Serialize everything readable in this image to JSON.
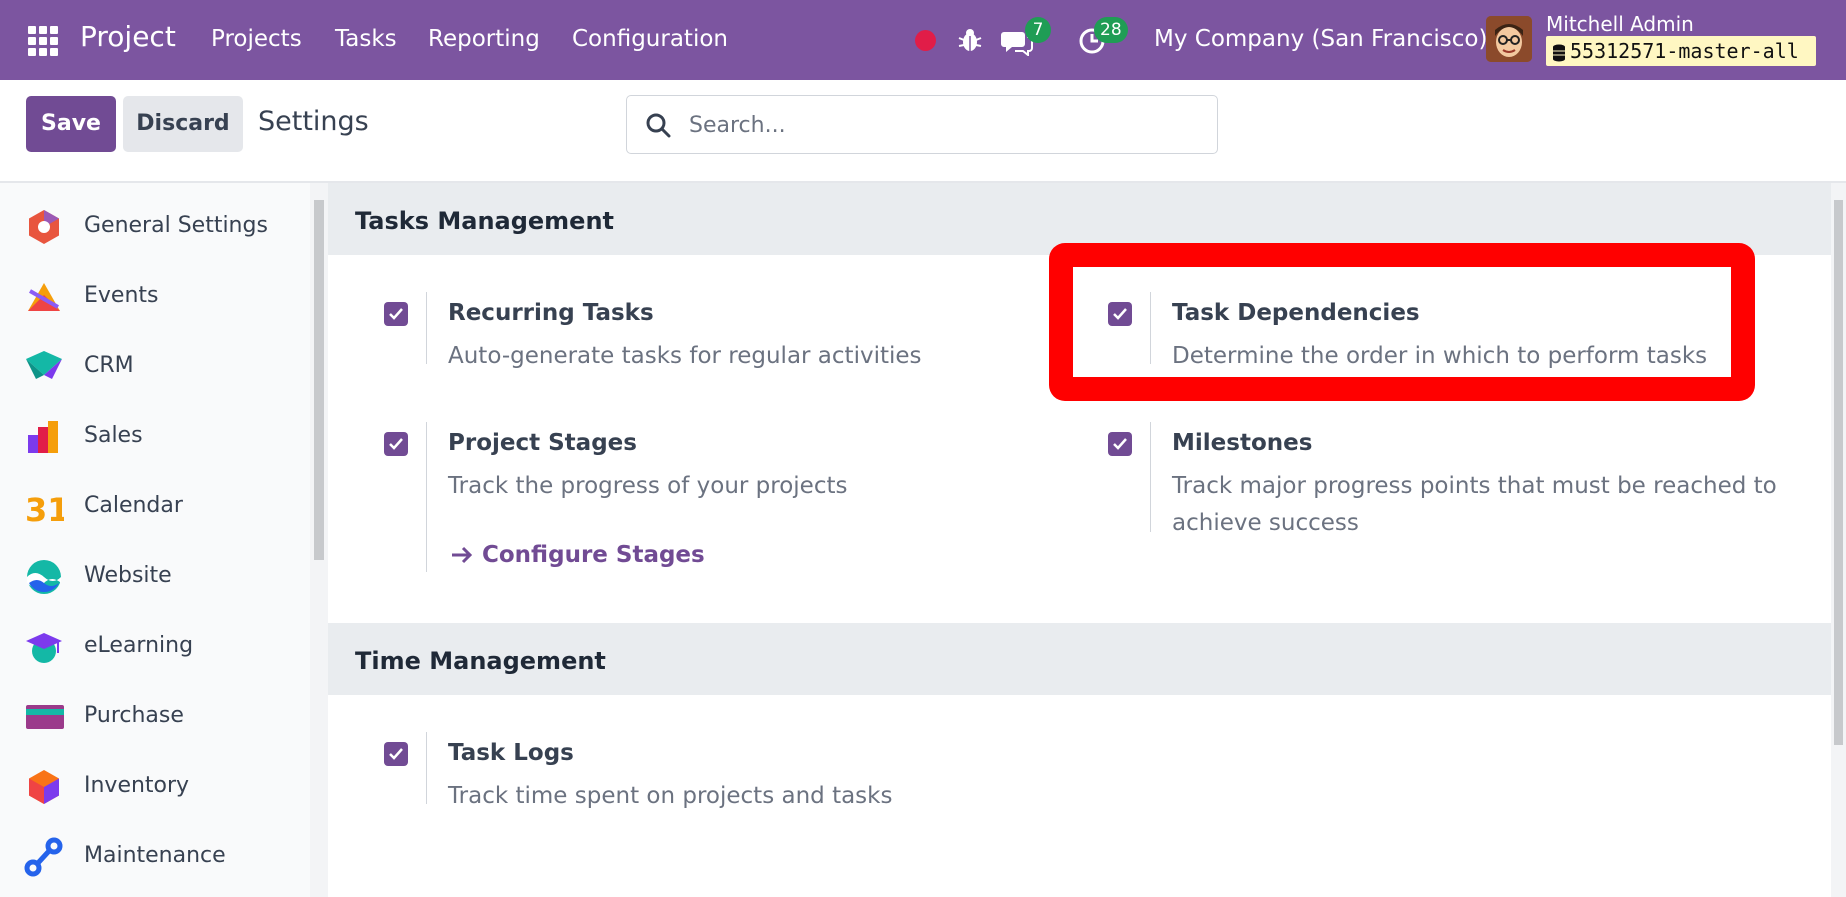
{
  "navbar": {
    "app_name": "Project",
    "menu": [
      "Projects",
      "Tasks",
      "Reporting",
      "Configuration"
    ],
    "messages_count": "7",
    "activities_count": "28",
    "company": "My Company (San Francisco)",
    "user_name": "Mitchell Admin",
    "database": "55312571-master-all",
    "colors": {
      "bar": "#7c55a0",
      "badge": "#1f9d55",
      "recording": "#e11d48"
    }
  },
  "control_panel": {
    "save_label": "Save",
    "discard_label": "Discard",
    "title": "Settings",
    "search_placeholder": "Search..."
  },
  "sidebar": {
    "items": [
      {
        "label": "General Settings",
        "icon": "general-settings-icon"
      },
      {
        "label": "Events",
        "icon": "events-icon"
      },
      {
        "label": "CRM",
        "icon": "crm-icon"
      },
      {
        "label": "Sales",
        "icon": "sales-icon"
      },
      {
        "label": "Calendar",
        "icon": "calendar-icon",
        "icon_text": "31"
      },
      {
        "label": "Website",
        "icon": "website-icon"
      },
      {
        "label": "eLearning",
        "icon": "elearning-icon"
      },
      {
        "label": "Purchase",
        "icon": "purchase-icon"
      },
      {
        "label": "Inventory",
        "icon": "inventory-icon"
      },
      {
        "label": "Maintenance",
        "icon": "maintenance-icon"
      }
    ]
  },
  "sections": [
    {
      "title": "Tasks Management",
      "settings": [
        {
          "title": "Recurring Tasks",
          "description": "Auto-generate tasks for regular activities",
          "checked": true
        },
        {
          "title": "Task Dependencies",
          "description": "Determine the order in which to perform tasks",
          "checked": true,
          "highlighted": true
        },
        {
          "title": "Project Stages",
          "description": "Track the progress of your projects",
          "checked": true,
          "link": "Configure Stages"
        },
        {
          "title": "Milestones",
          "description": "Track major progress points that must be reached to achieve success",
          "checked": true
        }
      ]
    },
    {
      "title": "Time Management",
      "settings": [
        {
          "title": "Task Logs",
          "description": "Track time spent on projects and tasks",
          "checked": true
        }
      ]
    }
  ],
  "theme": {
    "primary": "#714b94",
    "highlight": "#ff0000"
  }
}
